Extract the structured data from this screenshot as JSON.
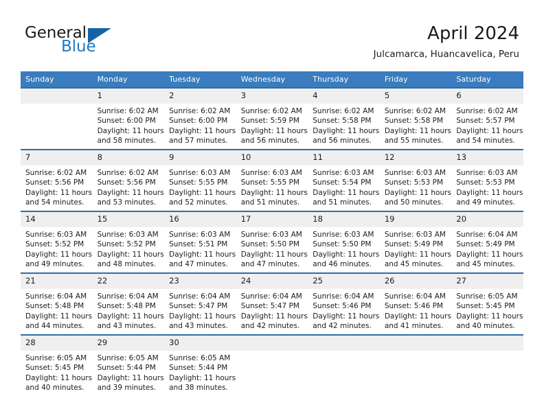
{
  "brand": {
    "name_part1": "General",
    "name_part2": "Blue",
    "triangle_icon": "triangle-icon",
    "accent_color": "#1f7ac4",
    "triangle_color": "#1464a5"
  },
  "header": {
    "title": "April 2024",
    "subtitle": "Julcamarca, Huancavelica, Peru"
  },
  "calendar": {
    "header_bg": "#3a7cbe",
    "daynum_bg": "#efefef",
    "separator_color": "#2e6da8",
    "weekday_headers": [
      "Sunday",
      "Monday",
      "Tuesday",
      "Wednesday",
      "Thursday",
      "Friday",
      "Saturday"
    ],
    "weeks": [
      [
        {
          "day": "",
          "sunrise": "",
          "sunset": "",
          "daylight_line1": "",
          "daylight_line2": ""
        },
        {
          "day": "1",
          "sunrise": "Sunrise: 6:02 AM",
          "sunset": "Sunset: 6:00 PM",
          "daylight_line1": "Daylight: 11 hours",
          "daylight_line2": "and 58 minutes."
        },
        {
          "day": "2",
          "sunrise": "Sunrise: 6:02 AM",
          "sunset": "Sunset: 6:00 PM",
          "daylight_line1": "Daylight: 11 hours",
          "daylight_line2": "and 57 minutes."
        },
        {
          "day": "3",
          "sunrise": "Sunrise: 6:02 AM",
          "sunset": "Sunset: 5:59 PM",
          "daylight_line1": "Daylight: 11 hours",
          "daylight_line2": "and 56 minutes."
        },
        {
          "day": "4",
          "sunrise": "Sunrise: 6:02 AM",
          "sunset": "Sunset: 5:58 PM",
          "daylight_line1": "Daylight: 11 hours",
          "daylight_line2": "and 56 minutes."
        },
        {
          "day": "5",
          "sunrise": "Sunrise: 6:02 AM",
          "sunset": "Sunset: 5:58 PM",
          "daylight_line1": "Daylight: 11 hours",
          "daylight_line2": "and 55 minutes."
        },
        {
          "day": "6",
          "sunrise": "Sunrise: 6:02 AM",
          "sunset": "Sunset: 5:57 PM",
          "daylight_line1": "Daylight: 11 hours",
          "daylight_line2": "and 54 minutes."
        }
      ],
      [
        {
          "day": "7",
          "sunrise": "Sunrise: 6:02 AM",
          "sunset": "Sunset: 5:56 PM",
          "daylight_line1": "Daylight: 11 hours",
          "daylight_line2": "and 54 minutes."
        },
        {
          "day": "8",
          "sunrise": "Sunrise: 6:02 AM",
          "sunset": "Sunset: 5:56 PM",
          "daylight_line1": "Daylight: 11 hours",
          "daylight_line2": "and 53 minutes."
        },
        {
          "day": "9",
          "sunrise": "Sunrise: 6:03 AM",
          "sunset": "Sunset: 5:55 PM",
          "daylight_line1": "Daylight: 11 hours",
          "daylight_line2": "and 52 minutes."
        },
        {
          "day": "10",
          "sunrise": "Sunrise: 6:03 AM",
          "sunset": "Sunset: 5:55 PM",
          "daylight_line1": "Daylight: 11 hours",
          "daylight_line2": "and 51 minutes."
        },
        {
          "day": "11",
          "sunrise": "Sunrise: 6:03 AM",
          "sunset": "Sunset: 5:54 PM",
          "daylight_line1": "Daylight: 11 hours",
          "daylight_line2": "and 51 minutes."
        },
        {
          "day": "12",
          "sunrise": "Sunrise: 6:03 AM",
          "sunset": "Sunset: 5:53 PM",
          "daylight_line1": "Daylight: 11 hours",
          "daylight_line2": "and 50 minutes."
        },
        {
          "day": "13",
          "sunrise": "Sunrise: 6:03 AM",
          "sunset": "Sunset: 5:53 PM",
          "daylight_line1": "Daylight: 11 hours",
          "daylight_line2": "and 49 minutes."
        }
      ],
      [
        {
          "day": "14",
          "sunrise": "Sunrise: 6:03 AM",
          "sunset": "Sunset: 5:52 PM",
          "daylight_line1": "Daylight: 11 hours",
          "daylight_line2": "and 49 minutes."
        },
        {
          "day": "15",
          "sunrise": "Sunrise: 6:03 AM",
          "sunset": "Sunset: 5:52 PM",
          "daylight_line1": "Daylight: 11 hours",
          "daylight_line2": "and 48 minutes."
        },
        {
          "day": "16",
          "sunrise": "Sunrise: 6:03 AM",
          "sunset": "Sunset: 5:51 PM",
          "daylight_line1": "Daylight: 11 hours",
          "daylight_line2": "and 47 minutes."
        },
        {
          "day": "17",
          "sunrise": "Sunrise: 6:03 AM",
          "sunset": "Sunset: 5:50 PM",
          "daylight_line1": "Daylight: 11 hours",
          "daylight_line2": "and 47 minutes."
        },
        {
          "day": "18",
          "sunrise": "Sunrise: 6:03 AM",
          "sunset": "Sunset: 5:50 PM",
          "daylight_line1": "Daylight: 11 hours",
          "daylight_line2": "and 46 minutes."
        },
        {
          "day": "19",
          "sunrise": "Sunrise: 6:03 AM",
          "sunset": "Sunset: 5:49 PM",
          "daylight_line1": "Daylight: 11 hours",
          "daylight_line2": "and 45 minutes."
        },
        {
          "day": "20",
          "sunrise": "Sunrise: 6:04 AM",
          "sunset": "Sunset: 5:49 PM",
          "daylight_line1": "Daylight: 11 hours",
          "daylight_line2": "and 45 minutes."
        }
      ],
      [
        {
          "day": "21",
          "sunrise": "Sunrise: 6:04 AM",
          "sunset": "Sunset: 5:48 PM",
          "daylight_line1": "Daylight: 11 hours",
          "daylight_line2": "and 44 minutes."
        },
        {
          "day": "22",
          "sunrise": "Sunrise: 6:04 AM",
          "sunset": "Sunset: 5:48 PM",
          "daylight_line1": "Daylight: 11 hours",
          "daylight_line2": "and 43 minutes."
        },
        {
          "day": "23",
          "sunrise": "Sunrise: 6:04 AM",
          "sunset": "Sunset: 5:47 PM",
          "daylight_line1": "Daylight: 11 hours",
          "daylight_line2": "and 43 minutes."
        },
        {
          "day": "24",
          "sunrise": "Sunrise: 6:04 AM",
          "sunset": "Sunset: 5:47 PM",
          "daylight_line1": "Daylight: 11 hours",
          "daylight_line2": "and 42 minutes."
        },
        {
          "day": "25",
          "sunrise": "Sunrise: 6:04 AM",
          "sunset": "Sunset: 5:46 PM",
          "daylight_line1": "Daylight: 11 hours",
          "daylight_line2": "and 42 minutes."
        },
        {
          "day": "26",
          "sunrise": "Sunrise: 6:04 AM",
          "sunset": "Sunset: 5:46 PM",
          "daylight_line1": "Daylight: 11 hours",
          "daylight_line2": "and 41 minutes."
        },
        {
          "day": "27",
          "sunrise": "Sunrise: 6:05 AM",
          "sunset": "Sunset: 5:45 PM",
          "daylight_line1": "Daylight: 11 hours",
          "daylight_line2": "and 40 minutes."
        }
      ],
      [
        {
          "day": "28",
          "sunrise": "Sunrise: 6:05 AM",
          "sunset": "Sunset: 5:45 PM",
          "daylight_line1": "Daylight: 11 hours",
          "daylight_line2": "and 40 minutes."
        },
        {
          "day": "29",
          "sunrise": "Sunrise: 6:05 AM",
          "sunset": "Sunset: 5:44 PM",
          "daylight_line1": "Daylight: 11 hours",
          "daylight_line2": "and 39 minutes."
        },
        {
          "day": "30",
          "sunrise": "Sunrise: 6:05 AM",
          "sunset": "Sunset: 5:44 PM",
          "daylight_line1": "Daylight: 11 hours",
          "daylight_line2": "and 38 minutes."
        },
        {
          "day": "",
          "sunrise": "",
          "sunset": "",
          "daylight_line1": "",
          "daylight_line2": ""
        },
        {
          "day": "",
          "sunrise": "",
          "sunset": "",
          "daylight_line1": "",
          "daylight_line2": ""
        },
        {
          "day": "",
          "sunrise": "",
          "sunset": "",
          "daylight_line1": "",
          "daylight_line2": ""
        },
        {
          "day": "",
          "sunrise": "",
          "sunset": "",
          "daylight_line1": "",
          "daylight_line2": ""
        }
      ]
    ]
  }
}
